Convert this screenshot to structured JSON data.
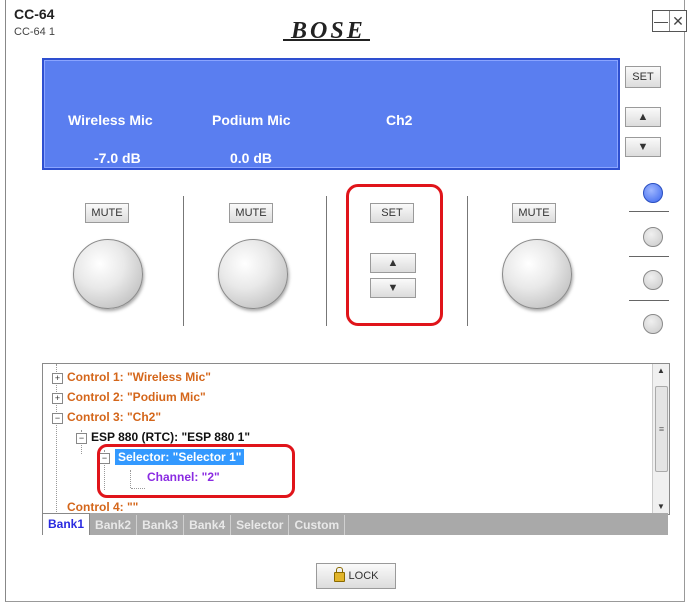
{
  "window": {
    "title": "CC-64",
    "subtitle": "CC-64 1",
    "brand": "BOSE",
    "minimize_icon": "minimize-icon",
    "close_icon": "close-icon"
  },
  "display": {
    "channels": [
      {
        "name": "Wireless Mic",
        "level": "-7.0 dB"
      },
      {
        "name": "Podium Mic",
        "level": "0.0 dB"
      },
      {
        "name": "Ch2",
        "level": ""
      }
    ],
    "background_color": "#5a7ef0"
  },
  "right_panel": {
    "set_label": "SET",
    "up_label": "▲",
    "down_label": "▼",
    "bank_indicators": 4,
    "active_indicator": 1
  },
  "controls": [
    {
      "button": "MUTE"
    },
    {
      "button": "MUTE"
    },
    {
      "button": "SET",
      "up": "▲",
      "down": "▼"
    },
    {
      "button": "MUTE"
    }
  ],
  "tree": {
    "items": [
      {
        "text": "Control 1: \"Wireless Mic\"",
        "color": "orange"
      },
      {
        "text": "Control 2: \"Podium Mic\"",
        "color": "orange"
      },
      {
        "text": "Control 3: \"Ch2\"",
        "color": "orange"
      },
      {
        "text": "ESP 880 (RTC): \"ESP 880 1\"",
        "color": "black"
      },
      {
        "text": "Selector: \"Selector 1\"",
        "color": "selected"
      },
      {
        "text": "Channel: \"2\"",
        "color": "purple"
      },
      {
        "text": "Control 4: \"\"",
        "color": "orange"
      }
    ]
  },
  "tabs": [
    "Bank1",
    "Bank2",
    "Bank3",
    "Bank4",
    "Selector",
    "Custom"
  ],
  "active_tab": "Bank1",
  "lock_label": "LOCK",
  "highlight_color": "#e0141a"
}
